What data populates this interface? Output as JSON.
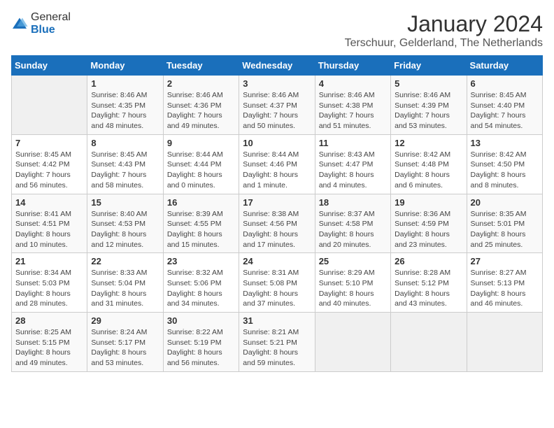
{
  "logo": {
    "general": "General",
    "blue": "Blue"
  },
  "header": {
    "month": "January 2024",
    "location": "Terschuur, Gelderland, The Netherlands"
  },
  "weekdays": [
    "Sunday",
    "Monday",
    "Tuesday",
    "Wednesday",
    "Thursday",
    "Friday",
    "Saturday"
  ],
  "weeks": [
    [
      {
        "day": "",
        "info": ""
      },
      {
        "day": "1",
        "info": "Sunrise: 8:46 AM\nSunset: 4:35 PM\nDaylight: 7 hours\nand 48 minutes."
      },
      {
        "day": "2",
        "info": "Sunrise: 8:46 AM\nSunset: 4:36 PM\nDaylight: 7 hours\nand 49 minutes."
      },
      {
        "day": "3",
        "info": "Sunrise: 8:46 AM\nSunset: 4:37 PM\nDaylight: 7 hours\nand 50 minutes."
      },
      {
        "day": "4",
        "info": "Sunrise: 8:46 AM\nSunset: 4:38 PM\nDaylight: 7 hours\nand 51 minutes."
      },
      {
        "day": "5",
        "info": "Sunrise: 8:46 AM\nSunset: 4:39 PM\nDaylight: 7 hours\nand 53 minutes."
      },
      {
        "day": "6",
        "info": "Sunrise: 8:45 AM\nSunset: 4:40 PM\nDaylight: 7 hours\nand 54 minutes."
      }
    ],
    [
      {
        "day": "7",
        "info": "Sunrise: 8:45 AM\nSunset: 4:42 PM\nDaylight: 7 hours\nand 56 minutes."
      },
      {
        "day": "8",
        "info": "Sunrise: 8:45 AM\nSunset: 4:43 PM\nDaylight: 7 hours\nand 58 minutes."
      },
      {
        "day": "9",
        "info": "Sunrise: 8:44 AM\nSunset: 4:44 PM\nDaylight: 8 hours\nand 0 minutes."
      },
      {
        "day": "10",
        "info": "Sunrise: 8:44 AM\nSunset: 4:46 PM\nDaylight: 8 hours\nand 1 minute."
      },
      {
        "day": "11",
        "info": "Sunrise: 8:43 AM\nSunset: 4:47 PM\nDaylight: 8 hours\nand 4 minutes."
      },
      {
        "day": "12",
        "info": "Sunrise: 8:42 AM\nSunset: 4:48 PM\nDaylight: 8 hours\nand 6 minutes."
      },
      {
        "day": "13",
        "info": "Sunrise: 8:42 AM\nSunset: 4:50 PM\nDaylight: 8 hours\nand 8 minutes."
      }
    ],
    [
      {
        "day": "14",
        "info": "Sunrise: 8:41 AM\nSunset: 4:51 PM\nDaylight: 8 hours\nand 10 minutes."
      },
      {
        "day": "15",
        "info": "Sunrise: 8:40 AM\nSunset: 4:53 PM\nDaylight: 8 hours\nand 12 minutes."
      },
      {
        "day": "16",
        "info": "Sunrise: 8:39 AM\nSunset: 4:55 PM\nDaylight: 8 hours\nand 15 minutes."
      },
      {
        "day": "17",
        "info": "Sunrise: 8:38 AM\nSunset: 4:56 PM\nDaylight: 8 hours\nand 17 minutes."
      },
      {
        "day": "18",
        "info": "Sunrise: 8:37 AM\nSunset: 4:58 PM\nDaylight: 8 hours\nand 20 minutes."
      },
      {
        "day": "19",
        "info": "Sunrise: 8:36 AM\nSunset: 4:59 PM\nDaylight: 8 hours\nand 23 minutes."
      },
      {
        "day": "20",
        "info": "Sunrise: 8:35 AM\nSunset: 5:01 PM\nDaylight: 8 hours\nand 25 minutes."
      }
    ],
    [
      {
        "day": "21",
        "info": "Sunrise: 8:34 AM\nSunset: 5:03 PM\nDaylight: 8 hours\nand 28 minutes."
      },
      {
        "day": "22",
        "info": "Sunrise: 8:33 AM\nSunset: 5:04 PM\nDaylight: 8 hours\nand 31 minutes."
      },
      {
        "day": "23",
        "info": "Sunrise: 8:32 AM\nSunset: 5:06 PM\nDaylight: 8 hours\nand 34 minutes."
      },
      {
        "day": "24",
        "info": "Sunrise: 8:31 AM\nSunset: 5:08 PM\nDaylight: 8 hours\nand 37 minutes."
      },
      {
        "day": "25",
        "info": "Sunrise: 8:29 AM\nSunset: 5:10 PM\nDaylight: 8 hours\nand 40 minutes."
      },
      {
        "day": "26",
        "info": "Sunrise: 8:28 AM\nSunset: 5:12 PM\nDaylight: 8 hours\nand 43 minutes."
      },
      {
        "day": "27",
        "info": "Sunrise: 8:27 AM\nSunset: 5:13 PM\nDaylight: 8 hours\nand 46 minutes."
      }
    ],
    [
      {
        "day": "28",
        "info": "Sunrise: 8:25 AM\nSunset: 5:15 PM\nDaylight: 8 hours\nand 49 minutes."
      },
      {
        "day": "29",
        "info": "Sunrise: 8:24 AM\nSunset: 5:17 PM\nDaylight: 8 hours\nand 53 minutes."
      },
      {
        "day": "30",
        "info": "Sunrise: 8:22 AM\nSunset: 5:19 PM\nDaylight: 8 hours\nand 56 minutes."
      },
      {
        "day": "31",
        "info": "Sunrise: 8:21 AM\nSunset: 5:21 PM\nDaylight: 8 hours\nand 59 minutes."
      },
      {
        "day": "",
        "info": ""
      },
      {
        "day": "",
        "info": ""
      },
      {
        "day": "",
        "info": ""
      }
    ]
  ]
}
